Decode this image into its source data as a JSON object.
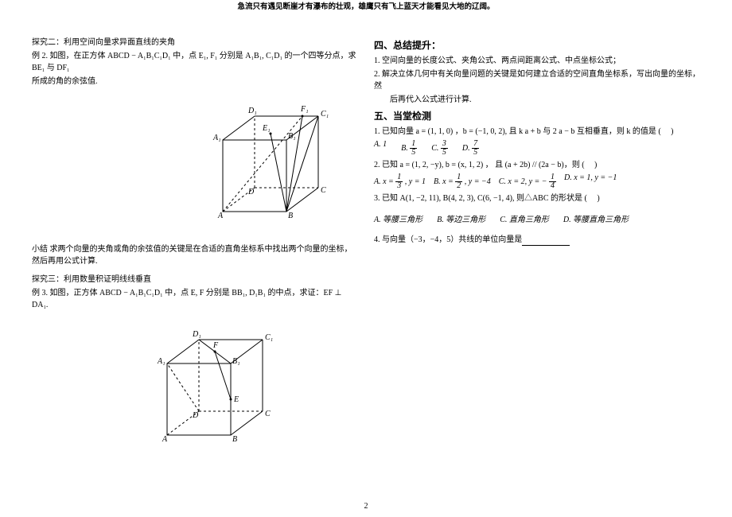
{
  "header": {
    "quote": "急流只有遇见断崖才有瀑布的壮观，雄鹰只有飞上蓝天才能看见大地的辽阔。"
  },
  "left": {
    "explore2_title": "探究二：利用空间向量求异面直线的夹角",
    "example2_line1": "例 2.  如图，在正方体 ABCD − A₁B₁C₁D₁ 中，点 E₁, F₁ 分别是 A₁B₁, C₁D₁ 的一个四等分点，求 BE₁ 与 DF₁",
    "example2_line2": "所成的角的余弦值.",
    "summary2": "小结  求两个向量的夹角或角的余弦值的关键是在合适的直角坐标系中找出两个向量的坐标，然后再用公式计算.",
    "explore3_title": "探究三：利用数量积证明线线垂直",
    "example3_line": "例 3. 如图，正方体 ABCD − A₁B₁C₁D₁ 中，点 E, F 分别是 BB₁, D₁B₁ 的中点，求证：EF ⊥ DA₁."
  },
  "right": {
    "section4_title": "四、总结提升：",
    "section4_item1": "1. 空间向量的长度公式、夹角公式、两点间距离公式、中点坐标公式；",
    "section4_item2_a": "2. 解决立体几何中有关向量问题的关键是如何建立合适的空间直角坐标系，写出向量的坐标，然",
    "section4_item2_b": "后再代入公式进行计算.",
    "section5_title": "五、当堂检测",
    "q1_stem_a": "1. 已知向量 a = (1, 1, 0) ，b = (−1, 0, 2), 且 k a + b 与 2 a − b 互相垂直，则 k 的值是 (",
    "q1_stem_b": ")",
    "q1_optA": "A. 1",
    "q1_optB_prefix": "B.",
    "q1_optB_num": "1",
    "q1_optB_den": "5",
    "q1_optC_prefix": "C.",
    "q1_optC_num": "3",
    "q1_optC_den": "5",
    "q1_optD_prefix": "D.",
    "q1_optD_num": "7",
    "q1_optD_den": "5",
    "q2_stem_a": "2. 已知  a = (1, 2, −y), b = (x, 1, 2) ， 且 (a + 2b) // (2a − b)，则 (",
    "q2_stem_b": ")",
    "q2_optA_prefix": "A.  x =",
    "q2_optA_num": "1",
    "q2_optA_den": "3",
    "q2_optA_suffix": ", y = 1",
    "q2_optB_prefix": "B.  x =",
    "q2_optB_num": "1",
    "q2_optB_den": "2",
    "q2_optB_suffix": ", y = −4",
    "q2_optC": "C.  x = 2, y = −",
    "q2_optC_num": "1",
    "q2_optC_den": "4",
    "q2_optD": "D.  x = 1, y = −1",
    "q3_stem_a": "3. 已知 A(1, −2, 11), B(4, 2, 3), C(6, −1, 4), 则△ABC 的形状是 (",
    "q3_stem_b": ")",
    "q3_optA": "A. 等腰三角形",
    "q3_optB": "B. 等边三角形",
    "q3_optC": "C. 直角三角形",
    "q3_optD": "D. 等腰直角三角形",
    "q4_stem": "4. 与向量（−3，−4，5）共线的单位向量是"
  },
  "page_number": "2"
}
